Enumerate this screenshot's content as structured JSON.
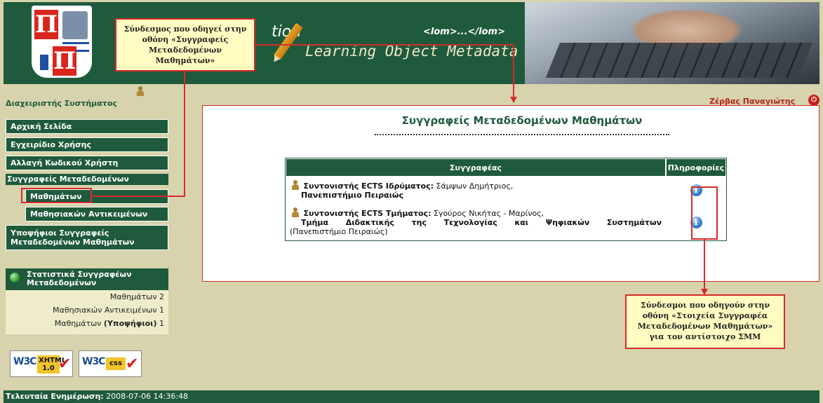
{
  "header": {
    "title_fragment": "tion",
    "lom_tag": "<lom>...</lom>",
    "subtitle": "Learning Object Metadata"
  },
  "callouts": {
    "top": "Σύνδεσμος που οδηγεί στην οθόνη «Συγγραφείς Μεταδεδομένων Μαθημάτων»",
    "bottom": "Σύνδεσμοι που οδηγούν στην οθόνη «Στοιχεία Συγγραφέα Μεταδεδομένων Μαθημάτων» για τον αντίστοιχο ΣΜΜ"
  },
  "sidebar": {
    "role_label": "Διαχειριστής Συστήματος",
    "nav": [
      {
        "label": "Αρχική Σελίδα"
      },
      {
        "label": "Εγχειρίδιο Χρήσης"
      },
      {
        "label": "Αλλαγή Κωδικού Χρήστη"
      }
    ],
    "section_label": "Συγγραφείς Μεταδεδομένων",
    "sub_items": [
      {
        "label": "Μαθημάτων"
      },
      {
        "label": "Μαθησιακών Αντικειμένων"
      }
    ],
    "candidates_label": "Υποψήφιοι Συγγραφείς Μεταδεδομένων Μαθημάτων"
  },
  "stats": {
    "title": "Στατιστικά Συγγραφέων Μεταδεδομένων",
    "rows": [
      {
        "label": "Μαθημάτων",
        "suffix": "",
        "value": "2"
      },
      {
        "label": "Μαθησιακών Αντικειμένων",
        "suffix": "",
        "value": "1"
      },
      {
        "label": "Μαθημάτων",
        "suffix": "(Υποψήφιοι)",
        "value": "1"
      }
    ]
  },
  "badges": {
    "xhtml_w3c": "W3C",
    "xhtml_label": "XHTML 1.0",
    "css_w3c": "W3C",
    "css_label": "css"
  },
  "user": {
    "name": "Ζέρβας Παναγιώτης"
  },
  "main": {
    "title": "Συγγραφείς Μεταδεδομένων Μαθημάτων",
    "table": {
      "col_author": "Συγγραφέας",
      "col_info": "Πληροφορίες",
      "rows": [
        {
          "role": "Συντονιστής ECTS Ιδρύματος:",
          "name": "Σάμψων Δημήτριος,",
          "org": "Πανεπιστήμιο Πειραιώς",
          "org_extra": ""
        },
        {
          "role": "Συντονιστής ECTS Τμήματος:",
          "name": "Σγούρος Νικήτας - Μαρίνος,",
          "org": "Τμήμα Διδακτικής της Τεχνολογίας και Ψηφιακών Συστημάτων",
          "org_extra": "(Πανεπιστήμιο Πειραιώς)"
        }
      ]
    }
  },
  "footer": {
    "label": "Τελευταία Ενημέρωση:",
    "timestamp": "2008-07-06 14:36:48"
  }
}
